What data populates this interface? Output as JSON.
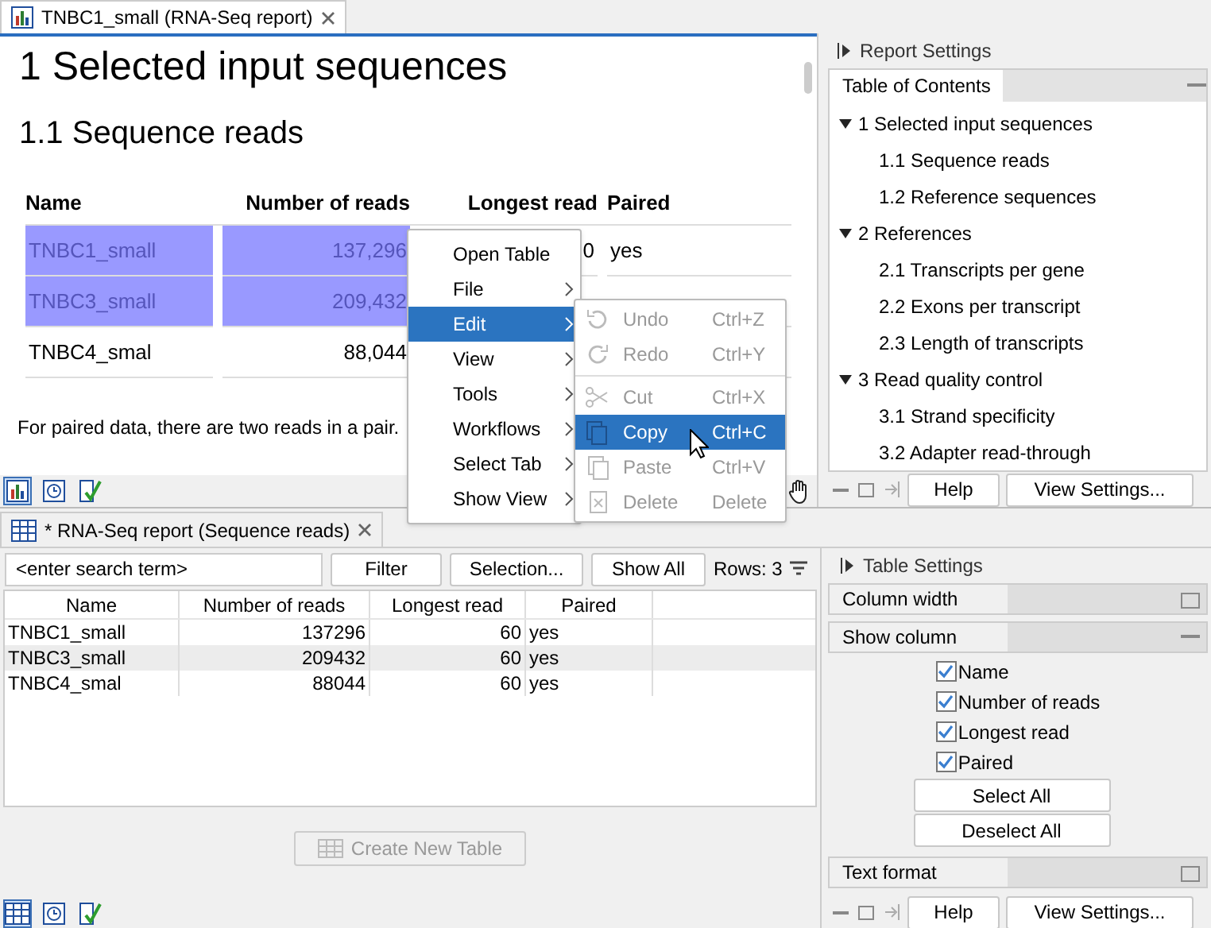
{
  "report_tab": {
    "title": "TNBC1_small (RNA-Seq report)"
  },
  "report": {
    "heading": "1 Selected input sequences",
    "subheading": "1.1 Sequence reads",
    "columns": [
      "Name",
      "Number of reads",
      "Longest read",
      "Paired"
    ],
    "rows": [
      {
        "selected": true,
        "cells": [
          "TNBC1_small",
          "137,296",
          "0",
          "yes"
        ]
      },
      {
        "selected": true,
        "cells": [
          "TNBC3_small",
          "209,432"
        ]
      },
      {
        "selected": false,
        "cells": [
          "TNBC4_smal",
          "88,044"
        ]
      }
    ],
    "note": "For paired data, there are two reads in a pair."
  },
  "context_menu": [
    {
      "label": "Open Table",
      "submenu": false,
      "selected": false
    },
    {
      "label": "File",
      "submenu": true,
      "selected": false
    },
    {
      "label": "Edit",
      "submenu": true,
      "selected": true
    },
    {
      "label": "View",
      "submenu": true,
      "selected": false
    },
    {
      "label": "Tools",
      "submenu": true,
      "selected": false
    },
    {
      "label": "Workflows",
      "submenu": true,
      "selected": false
    },
    {
      "label": "Select Tab",
      "submenu": true,
      "selected": false
    },
    {
      "label": "Show View",
      "submenu": true,
      "selected": false
    }
  ],
  "edit_submenu": [
    {
      "kind": "undo",
      "label": "Undo",
      "shortcut": "Ctrl+Z",
      "disabled": true,
      "selected": false
    },
    {
      "kind": "redo",
      "label": "Redo",
      "shortcut": "Ctrl+Y",
      "disabled": true,
      "selected": false
    },
    {
      "kind": "cut",
      "label": "Cut",
      "shortcut": "Ctrl+X",
      "disabled": true,
      "selected": false
    },
    {
      "kind": "copy",
      "label": "Copy",
      "shortcut": "Ctrl+C",
      "disabled": false,
      "selected": true
    },
    {
      "kind": "paste",
      "label": "Paste",
      "shortcut": "Ctrl+V",
      "disabled": true,
      "selected": false
    },
    {
      "kind": "delete",
      "label": "Delete",
      "shortcut": "Delete",
      "disabled": true,
      "selected": false
    }
  ],
  "report_settings": {
    "title": "Report Settings",
    "toc_title": "Table of Contents",
    "toc": [
      {
        "label": "1 Selected input sequences",
        "expanded": true,
        "children": [
          {
            "label": "1.1 Sequence reads"
          },
          {
            "label": "1.2 Reference sequences"
          }
        ]
      },
      {
        "label": "2 References",
        "expanded": true,
        "children": [
          {
            "label": "2.1 Transcripts per gene"
          },
          {
            "label": "2.2 Exons per transcript"
          },
          {
            "label": "2.3 Length of transcripts"
          }
        ]
      },
      {
        "label": "3 Read quality control",
        "expanded": true,
        "children": [
          {
            "label": "3.1 Strand specificity"
          },
          {
            "label": "3.2 Adapter read-through"
          }
        ]
      }
    ],
    "buttons": [
      "Help",
      "View Settings..."
    ]
  },
  "table_tab": {
    "title": "* RNA-Seq report (Sequence reads)"
  },
  "table_toolbar": {
    "search_placeholder": "<enter search term>",
    "buttons": [
      "Filter",
      "Selection...",
      "Show All"
    ],
    "rows_label": "Rows: 3"
  },
  "data_table": {
    "columns": [
      "Name",
      "Number of reads",
      "Longest read",
      "Paired"
    ],
    "rows": [
      [
        "TNBC1_small",
        "137296",
        "60",
        "yes"
      ],
      [
        "TNBC3_small",
        "209432",
        "60",
        "yes"
      ],
      [
        "TNBC4_smal",
        "88044",
        "60",
        "yes"
      ]
    ]
  },
  "create_table_button": {
    "label": "Create New Table",
    "disabled": true
  },
  "table_settings": {
    "title": "Table Settings",
    "sections": [
      {
        "title": "Column width",
        "expanded": false
      },
      {
        "title": "Show column",
        "expanded": true,
        "checkboxes": [
          {
            "label": "Name",
            "checked": true
          },
          {
            "label": "Number of reads",
            "checked": true
          },
          {
            "label": "Longest read",
            "checked": true
          },
          {
            "label": "Paired",
            "checked": true
          }
        ],
        "buttons": [
          "Select All",
          "Deselect All"
        ]
      },
      {
        "title": "Text format",
        "expanded": false
      }
    ],
    "buttons": [
      "Help",
      "View Settings..."
    ]
  }
}
